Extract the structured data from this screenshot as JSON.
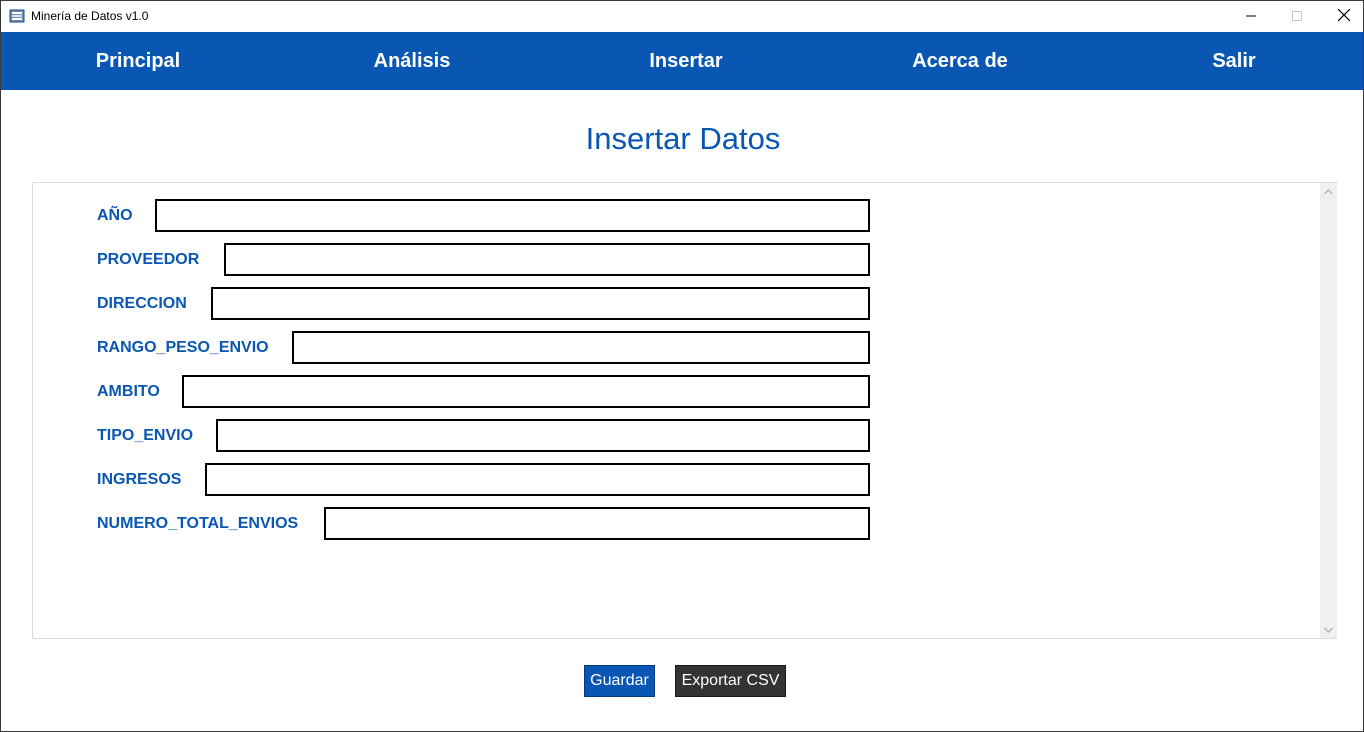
{
  "window": {
    "title": "Minería de Datos v1.0",
    "app_icon": "database-icon",
    "controls": {
      "minimize": "minimize-icon",
      "maximize": "maximize-icon",
      "close": "close-icon"
    }
  },
  "colors": {
    "accent": "#0a57b3",
    "nav_text": "#ffffff",
    "export_button": "#333333"
  },
  "nav": {
    "items": [
      {
        "label": "Principal"
      },
      {
        "label": "Análisis"
      },
      {
        "label": "Insertar"
      },
      {
        "label": "Acerca de"
      },
      {
        "label": "Salir"
      }
    ]
  },
  "page": {
    "title": "Insertar Datos"
  },
  "form": {
    "fields": [
      {
        "label": "AÑO",
        "value": ""
      },
      {
        "label": "PROVEEDOR",
        "value": ""
      },
      {
        "label": "DIRECCION",
        "value": ""
      },
      {
        "label": "RANGO_PESO_ENVIO",
        "value": ""
      },
      {
        "label": "AMBITO",
        "value": ""
      },
      {
        "label": "TIPO_ENVIO",
        "value": ""
      },
      {
        "label": "INGRESOS",
        "value": ""
      },
      {
        "label": "NUMERO_TOTAL_ENVIOS",
        "value": ""
      }
    ]
  },
  "buttons": {
    "save_label": "Guardar",
    "export_label": "Exportar CSV"
  }
}
